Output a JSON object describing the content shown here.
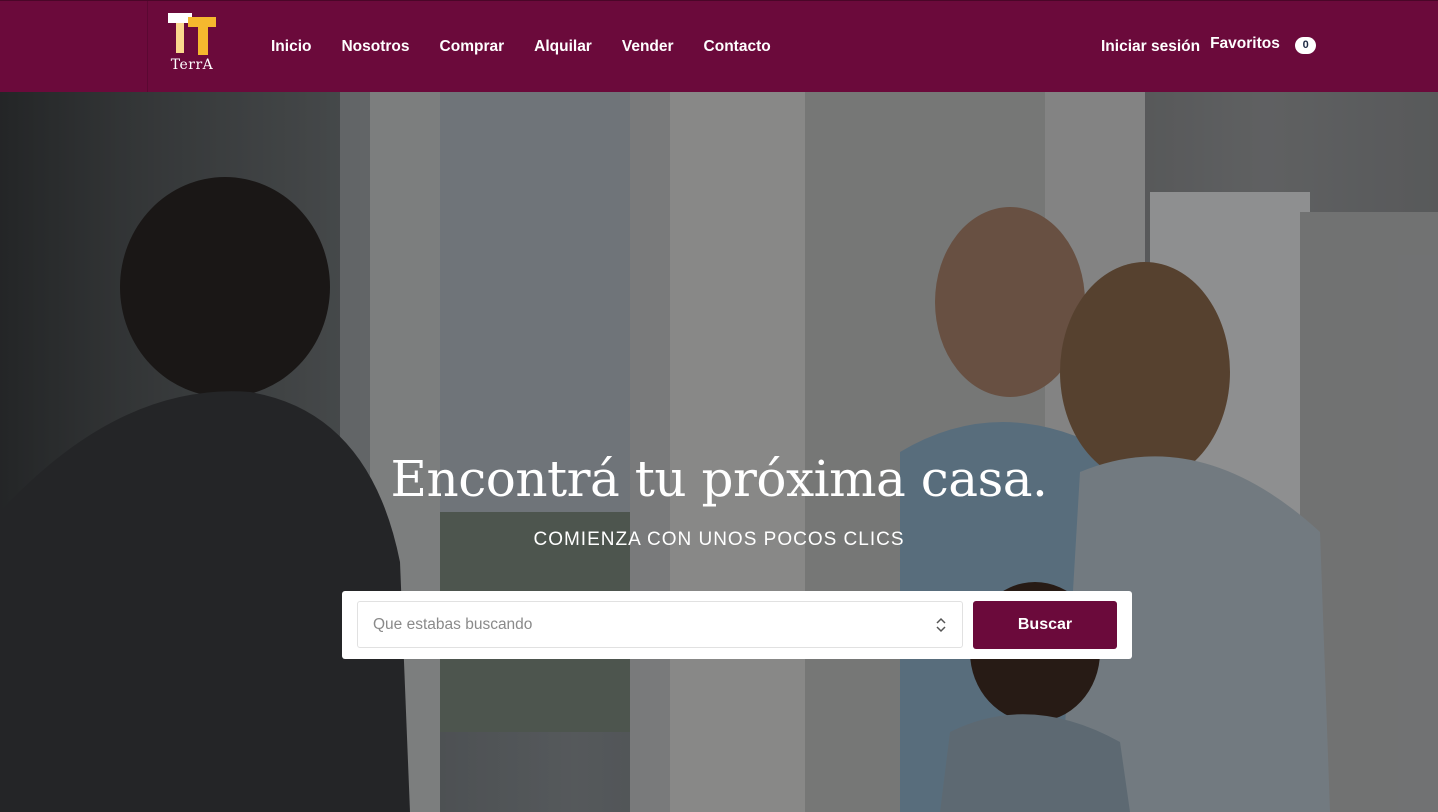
{
  "header": {
    "logo_text": "TerrA",
    "nav": [
      {
        "label": "Inicio"
      },
      {
        "label": "Nosotros"
      },
      {
        "label": "Comprar"
      },
      {
        "label": "Alquilar"
      },
      {
        "label": "Vender"
      },
      {
        "label": "Contacto"
      }
    ],
    "login_label": "Iniciar sesión",
    "favorites_label": "Favoritos",
    "favorites_count": "0"
  },
  "hero": {
    "title": "Encontrá tu próxima casa.",
    "subtitle": "COMIENZA CON UNOS POCOS CLICS",
    "search": {
      "placeholder": "Que estabas buscando",
      "button_label": "Buscar"
    }
  },
  "colors": {
    "brand": "#6b0a3b",
    "logo_yellow": "#f5b82e",
    "logo_white": "#ffffff"
  },
  "icons": {
    "logo": "terra-logo",
    "select_arrows": "chevron-up-down-icon"
  }
}
